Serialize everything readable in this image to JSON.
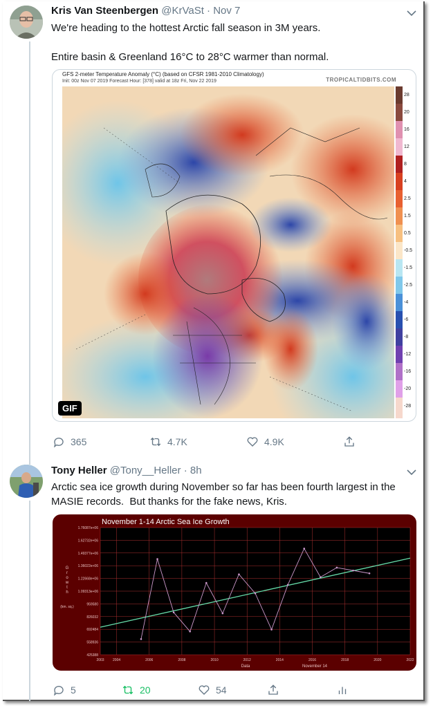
{
  "tweets": [
    {
      "name": "Kris Van Steenbergen",
      "handle": "@KrVaSt",
      "sep": "·",
      "time": "Nov 7",
      "text": "We're heading to the hottest Arctic fall season in 3M years.\n\nEntire basin & Greenland 16°C to 28°C warmer than normal.",
      "media": {
        "title": "GFS 2-meter Temperature Anomaly (°C) (based on CFSR 1981-2010 Climatology)",
        "subtitle": "Init: 00z Nov 07 2019   Forecast Hour: [378]   valid at 18z Fri, Nov 22 2019",
        "site": "TROPICALTIDBITS.COM",
        "badge": "GIF",
        "colorbar": [
          "28",
          "20",
          "16",
          "12",
          "8",
          "4",
          "2.5",
          "1.5",
          "0.5",
          "-0.5",
          "-1.5",
          "-2.5",
          "-4",
          "-6",
          "-8",
          "-12",
          "-16",
          "-20",
          "-28"
        ]
      },
      "actions": {
        "replies": "365",
        "retweets": "4.7K",
        "likes": "4.9K"
      }
    },
    {
      "name": "Tony Heller",
      "handle": "@Tony__Heller",
      "sep": "·",
      "time": "8h",
      "text": "Arctic sea ice growth during November so far has been fourth largest in the MASIE records.  But thanks for the fake news, Kris.",
      "actions": {
        "replies": "5",
        "retweets": "20",
        "likes": "54"
      }
    }
  ],
  "colors": {
    "retweet_active": "#17bf63",
    "chart_bg": "#5b0000",
    "plot_bg": "#000000",
    "trend": "#66ddaa",
    "series": "#cc99cc"
  },
  "chart_data": {
    "type": "line",
    "title": "November 1-14 Arctic Sea Ice Growth",
    "xlabel": "Data",
    "xlabel2": "November 14",
    "ylabel": "Growth",
    "ylabel_unit": "(km. sq.)",
    "x_ticks": [
      "2003",
      "2004",
      "2006",
      "2008",
      "2010",
      "2012",
      "2014",
      "2016",
      "2018",
      "2020",
      "2022"
    ],
    "y_ticks": [
      "1.76087e+06",
      "1.62732e+06",
      "1.49377e+06",
      "1.36022e+06",
      "1.22668e+06",
      "1.09313e+06",
      "959580",
      "826032",
      "692484",
      "558936",
      "425388"
    ],
    "xlim": [
      2003,
      2022
    ],
    "ylim": [
      425388,
      1760870
    ],
    "series": [
      {
        "x": [
          2005.5,
          2006.5,
          2007.5,
          2008.5,
          2009.5,
          2010.5,
          2011.5,
          2012.5,
          2013.5,
          2014.5,
          2015.5,
          2016.5,
          2017.5,
          2018.5,
          2019.5
        ],
        "values": [
          590000,
          1430000,
          870000,
          670000,
          1180000,
          860000,
          1270000,
          1070000,
          690000,
          1160000,
          1540000,
          1240000,
          1340000,
          1310000,
          1280000
        ]
      }
    ],
    "trend": {
      "x": [
        2003,
        2022
      ],
      "values": [
        715000,
        1440000
      ]
    }
  }
}
